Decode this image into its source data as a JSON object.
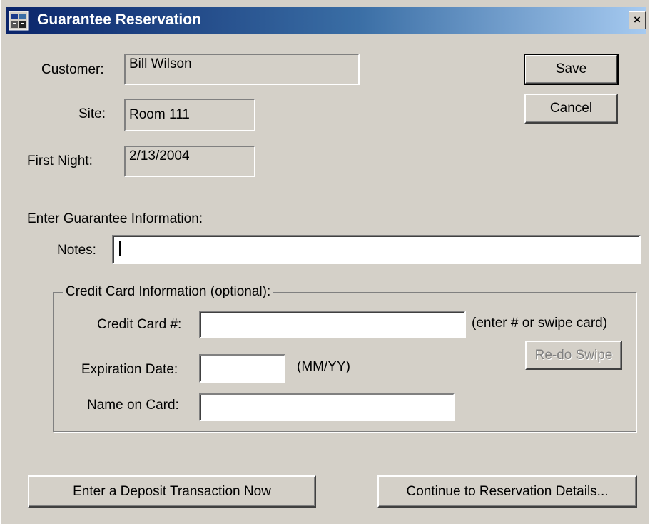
{
  "window": {
    "title": "Guarantee Reservation",
    "icon": "app-icon",
    "close_glyph": "×"
  },
  "fields": {
    "customer_label": "Customer:",
    "customer_value": "Bill Wilson",
    "site_label": "Site:",
    "site_value": "Room 111",
    "first_night_label": "First Night:",
    "first_night_value": "2/13/2004"
  },
  "buttons": {
    "save": "Save",
    "cancel": "Cancel",
    "redo_swipe": "Re-do Swipe",
    "deposit": "Enter a Deposit Transaction Now",
    "continue": "Continue to Reservation Details..."
  },
  "guarantee": {
    "heading": "Enter Guarantee Information:",
    "notes_label": "Notes:",
    "notes_value": ""
  },
  "credit_card": {
    "group_title": "Credit Card Information (optional):",
    "card_number_label": "Credit Card #:",
    "card_number_hint": "(enter # or swipe card)",
    "expiration_label": "Expiration Date:",
    "expiration_hint": "(MM/YY)",
    "name_label": "Name on Card:",
    "card_number_value": "",
    "expiration_value": "",
    "name_value": ""
  },
  "colors": {
    "dialog_bg": "#d4d0c8",
    "title_start": "#0a246a",
    "title_end": "#a6caf0"
  }
}
